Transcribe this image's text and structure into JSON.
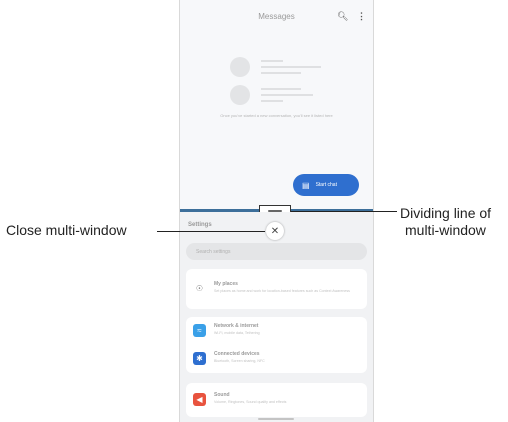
{
  "top_app": {
    "title": "Messages",
    "search_icon": "search-icon",
    "more_icon": "more-vert-icon",
    "empty_text": "Once you've started a new conversation, you'll see it listed here",
    "fab_label": "Start chat"
  },
  "bottom_app": {
    "title": "Settings",
    "search_placeholder": "Search settings",
    "items": [
      {
        "title": "My places",
        "subtitle": "Set places as home and work for location-based features such as Context Awareness",
        "icon": "location-pin-icon",
        "color": "#ffffff"
      },
      {
        "title": "Network & internet",
        "subtitle": "Wi-Fi, mobile data, Tethering",
        "icon": "wifi-icon",
        "color": "#3aa0e8"
      },
      {
        "title": "Connected devices",
        "subtitle": "Bluetooth, Screen sharing, NFC",
        "icon": "bluetooth-icon",
        "color": "#2e6fd0"
      },
      {
        "title": "Sound",
        "subtitle": "Volume, Ringtones, Sound quality and effects",
        "icon": "sound-icon",
        "color": "#e8533e"
      }
    ]
  },
  "callouts": {
    "close": "Close multi-window",
    "divider_line1": "Dividing line of",
    "divider_line2": "multi-window"
  },
  "colors": {
    "fab": "#2f6fcf",
    "divider": "#3d6f9a"
  }
}
